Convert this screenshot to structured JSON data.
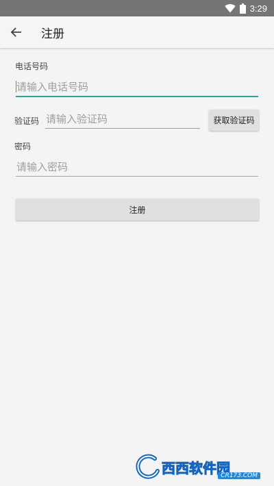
{
  "status_bar": {
    "time": "3:29",
    "icons": [
      "wifi-icon",
      "battery-icon"
    ]
  },
  "app_bar": {
    "back_icon": "arrow-left-icon",
    "title": "注册"
  },
  "form": {
    "phone_label": "电话号码",
    "phone_placeholder": "请输入电话号码",
    "code_label": "验证码",
    "code_placeholder": "请输入验证码",
    "get_code_button": "获取验证码",
    "password_label": "密码",
    "password_placeholder": "请输入密码",
    "register_button": "注册"
  },
  "watermark": {
    "brand": "西西软件园",
    "domain": "CR173.COM"
  },
  "colors": {
    "accent": "#26a69a",
    "status_bar": "#757575",
    "background": "#f4f4f4",
    "button": "#e0e0e0"
  }
}
